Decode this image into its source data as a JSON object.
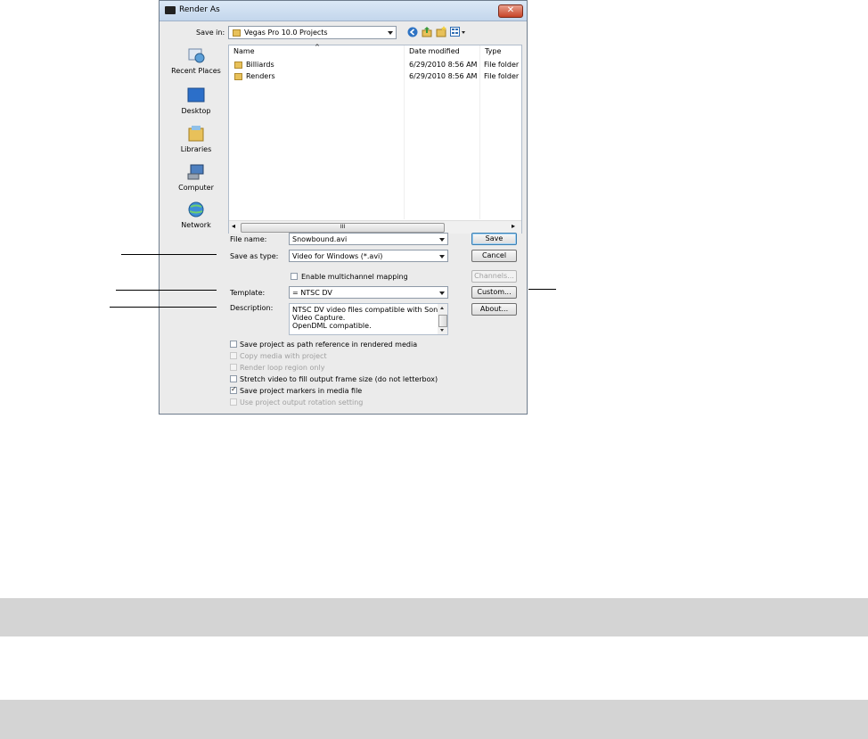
{
  "dialog": {
    "title": "Render As",
    "close_glyph": "✕"
  },
  "save_in": {
    "label": "Save in:",
    "value": "Vegas Pro 10.0 Projects"
  },
  "toolbar": {
    "icons": [
      "back-icon",
      "up-folder-icon",
      "new-folder-icon",
      "views-menu-icon"
    ]
  },
  "places": [
    {
      "label": "Recent Places",
      "icon": "recent-places-icon"
    },
    {
      "label": "Desktop",
      "icon": "desktop-icon"
    },
    {
      "label": "Libraries",
      "icon": "libraries-icon"
    },
    {
      "label": "Computer",
      "icon": "computer-icon"
    },
    {
      "label": "Network",
      "icon": "network-icon"
    }
  ],
  "file_list": {
    "columns": [
      "Name",
      "Date modified",
      "Type"
    ],
    "rows": [
      {
        "name": "Billiards",
        "date": "6/29/2010 8:56 AM",
        "type": "File folder"
      },
      {
        "name": "Renders",
        "date": "6/29/2010 8:56 AM",
        "type": "File folder"
      }
    ],
    "scroll_thumb_glyph": "III",
    "scroll_left": "◂",
    "scroll_right": "▸"
  },
  "file_name": {
    "label": "File name:",
    "value": "Snowbound.avi"
  },
  "save_as_type": {
    "label": "Save as type:",
    "value": "Video for Windows (*.avi)"
  },
  "multichannel": {
    "label": "Enable multichannel mapping",
    "checked": false
  },
  "template": {
    "label": "Template:",
    "value": "= NTSC DV"
  },
  "description": {
    "label": "Description:",
    "lines": [
      "NTSC DV video files compatible with Sony",
      "Video Capture.",
      "OpenDML compatible."
    ]
  },
  "buttons": {
    "save": "Save",
    "cancel": "Cancel",
    "channels": "Channels...",
    "custom": "Custom...",
    "about": "About..."
  },
  "options": [
    {
      "label": "Save project as path reference in rendered media",
      "checked": false,
      "enabled": true
    },
    {
      "label": "Copy media with project",
      "checked": false,
      "enabled": false
    },
    {
      "label": "Render loop region only",
      "checked": false,
      "enabled": false
    },
    {
      "label": "Stretch video to fill output frame size (do not letterbox)",
      "checked": false,
      "enabled": true
    },
    {
      "label": "Save project markers in media file",
      "checked": true,
      "enabled": true
    },
    {
      "label": "Use project output rotation setting",
      "checked": false,
      "enabled": false
    }
  ],
  "colors": {
    "dialog_bg": "#ebebeb",
    "title_bar": "#c3d6ec",
    "close_button": "#c64327",
    "page_band": "#d4d4d4"
  }
}
